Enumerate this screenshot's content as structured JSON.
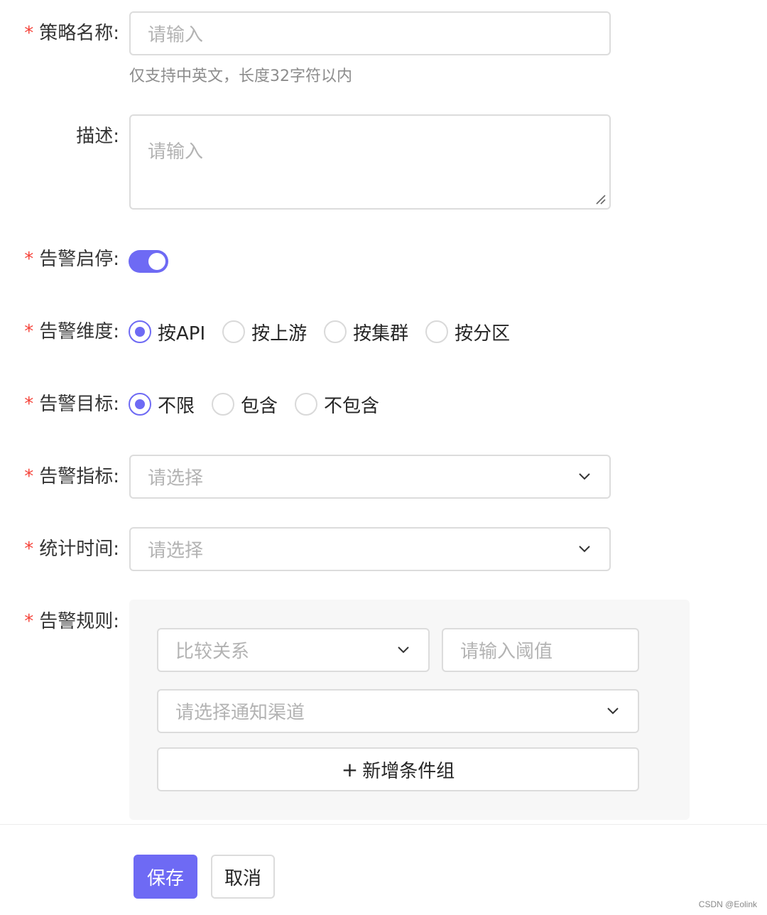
{
  "form": {
    "strategy_name": {
      "label": "策略名称:",
      "required": "*",
      "placeholder": "请输入",
      "hint": "仅支持中英文，长度32字符以内"
    },
    "description": {
      "label": "描述:",
      "placeholder": "请输入"
    },
    "alert_toggle": {
      "label": "告警启停:",
      "required": "*",
      "on": true
    },
    "alert_dimension": {
      "label": "告警维度:",
      "required": "*",
      "options": [
        "按API",
        "按上游",
        "按集群",
        "按分区"
      ],
      "selected": "按API"
    },
    "alert_target": {
      "label": "告警目标:",
      "required": "*",
      "options": [
        "不限",
        "包含",
        "不包含"
      ],
      "selected": "不限"
    },
    "alert_metric": {
      "label": "告警指标:",
      "required": "*",
      "placeholder": "请选择"
    },
    "stat_time": {
      "label": "统计时间:",
      "required": "*",
      "placeholder": "请选择"
    },
    "alert_rule": {
      "label": "告警规则:",
      "required": "*",
      "compare_placeholder": "比较关系",
      "threshold_placeholder": "请输入阈值",
      "channel_placeholder": "请选择通知渠道",
      "add_group_label": "新增条件组",
      "add_group_plus": "+"
    }
  },
  "footer": {
    "save_label": "保存",
    "cancel_label": "取消"
  },
  "watermark": "CSDN @Eolink",
  "colors": {
    "accent": "#6e6af4",
    "required": "#f5443b",
    "border": "#dcdcdc",
    "placeholder": "#b3b3b3"
  },
  "icons": {
    "select_arrow": "chevron-down-icon",
    "textarea_resize": "resize-handle-icon"
  }
}
